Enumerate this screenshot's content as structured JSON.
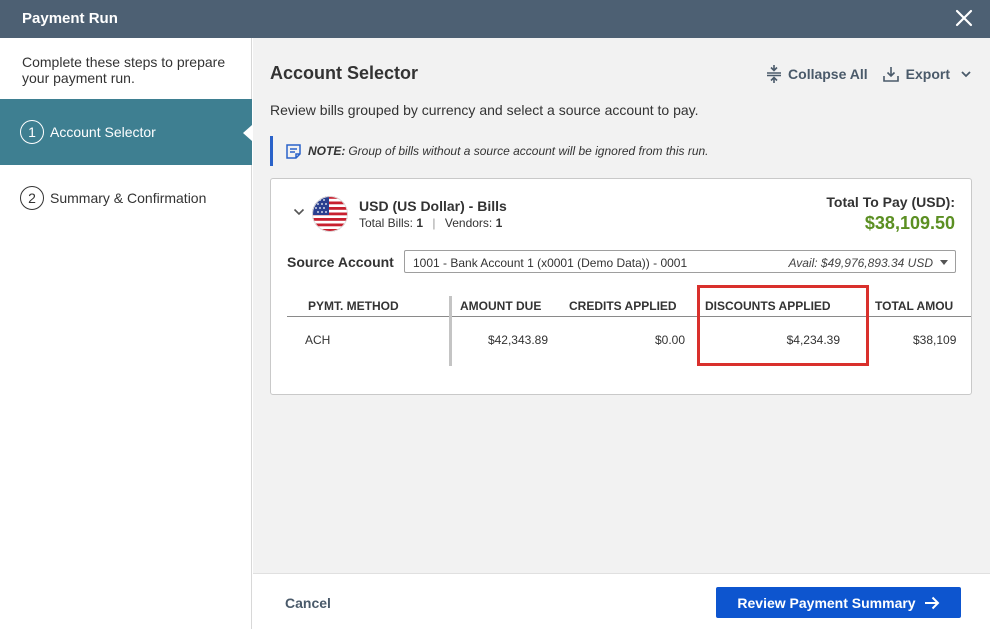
{
  "dialog": {
    "title": "Payment Run"
  },
  "sidebar": {
    "intro": "Complete these steps to prepare your payment run.",
    "steps": [
      {
        "num": "1",
        "label": "Account Selector",
        "active": true
      },
      {
        "num": "2",
        "label": "Summary & Confirmation",
        "active": false
      }
    ]
  },
  "main": {
    "heading": "Account Selector",
    "description": "Review bills grouped by currency and select a source account to pay.",
    "toolbar": {
      "collapse_label": "Collapse All",
      "export_label": "Export"
    },
    "note": {
      "label": "NOTE:",
      "text": "Group of bills without a source account will be ignored from this run."
    }
  },
  "currency_group": {
    "title": "USD (US Dollar) - Bills",
    "total_bills_label": "Total Bills:",
    "total_bills": "1",
    "vendors_label": "Vendors:",
    "vendors": "1",
    "total_label": "Total To Pay (USD):",
    "total_value": "$38,109.50",
    "source_account_label": "Source Account",
    "source_account_value": "1001 - Bank Account 1 (x0001 (Demo Data)) - 0001",
    "source_account_avail": "Avail: $49,976,893.34 USD",
    "table": {
      "headers": {
        "pymt_method": "PYMT. METHOD",
        "amount_due": "AMOUNT DUE",
        "credits_applied": "CREDITS APPLIED",
        "discounts_applied": "DISCOUNTS APPLIED",
        "total_amount": "TOTAL AMOU"
      },
      "row": {
        "pymt_method": "ACH",
        "amount_due": "$42,343.89",
        "credits_applied": "$0.00",
        "discounts_applied": "$4,234.39",
        "total_amount": "$38,109"
      }
    }
  },
  "footer": {
    "cancel_label": "Cancel",
    "primary_label": "Review Payment Summary"
  },
  "colors": {
    "titlebar": "#4d6073",
    "active_step": "#3e7f91",
    "total_green": "#5b8f22",
    "primary_button": "#0d55cf",
    "highlight_red": "#d9302c",
    "note_accent": "#2a62c9"
  },
  "icons": [
    "close-icon",
    "collapse-all-icon",
    "export-icon",
    "chevron-down-icon",
    "note-icon",
    "us-flag-icon",
    "arrow-right-icon"
  ]
}
